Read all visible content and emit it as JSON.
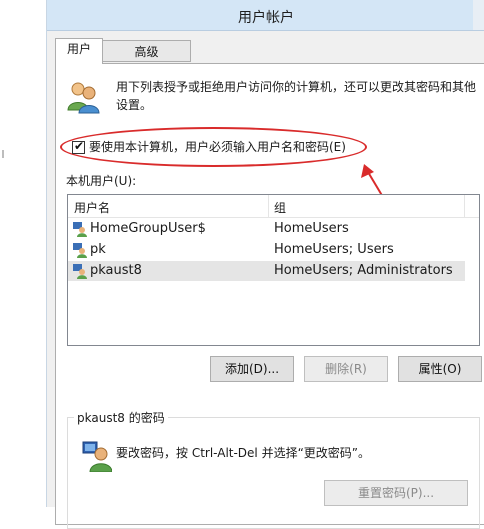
{
  "window": {
    "title": "用户帐户"
  },
  "tabs": [
    {
      "label": "用户",
      "active": true
    },
    {
      "label": "高级",
      "active": false
    }
  ],
  "intro_text": "用下列表授予或拒绝用户访问你的计算机，还可以更改其密码和其他设置。",
  "require_password": {
    "label": "要使用本计算机，用户必须输入用户名和密码(E)",
    "checked": true
  },
  "users_list": {
    "label": "本机用户(U):",
    "columns": [
      "用户名",
      "组"
    ],
    "rows": [
      {
        "name": "HomeGroupUser$",
        "group": "HomeUsers",
        "selected": false
      },
      {
        "name": "pk",
        "group": "HomeUsers; Users",
        "selected": false
      },
      {
        "name": "pkaust8",
        "group": "HomeUsers; Administrators",
        "selected": true
      }
    ]
  },
  "buttons": {
    "add": "添加(D)...",
    "remove": "删除(R)",
    "properties": "属性(O)"
  },
  "password_group": {
    "title": "pkaust8 的密码",
    "text": "要改密码，按 Ctrl-Alt-Del 并选择“更改密码”。",
    "reset_button": "重置密码(P)..."
  },
  "colors": {
    "annotation": "#d92b2b",
    "titlebar": "#d4e6f6"
  }
}
